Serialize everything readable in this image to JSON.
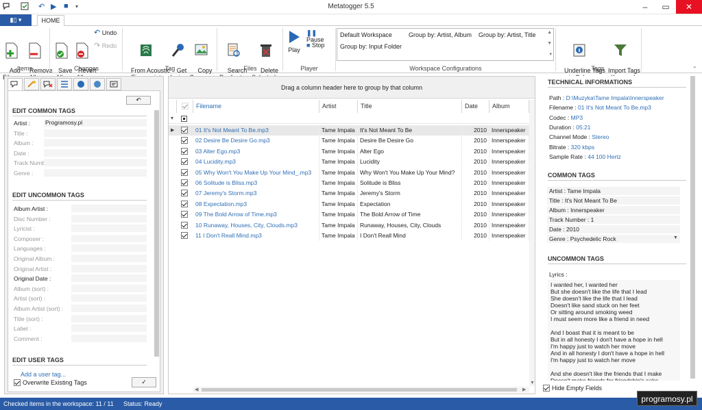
{
  "app": {
    "title": "Metatogger 5.5"
  },
  "ribbon": {
    "file_tab": "▮▯ ▾",
    "home_tab": "HOME",
    "items": {
      "add": "Add\nFiles ▾",
      "remove": "Remove\nAll ▾",
      "save": "Save\nAll ▾",
      "revert": "Revert\nAll ▾",
      "undo": "Undo",
      "redo": "Redo",
      "acoustic": "From Acoustic\nFingerprint",
      "lyrics": "Get\nLyrics",
      "covers": "Copy\nCovers ▾",
      "search": "Search\nDuplicates",
      "delete": "Delete\nSelected ▾",
      "play": "Play",
      "pause": "Pause",
      "stop": "Stop",
      "underline": "Underline Tags\nin Color",
      "import": "Import Tags\nas Keywords"
    },
    "groups": {
      "items": "Items",
      "changes": "Changes",
      "tag": "Tag",
      "files": "Files",
      "player": "Player",
      "workspace": "Workspace Configurations",
      "tags": "Tags"
    },
    "workspace": [
      "Default Workspace",
      "Group by: Artist, Album",
      "Group by: Artist, Title",
      "Group by: Input Folder"
    ]
  },
  "left": {
    "common_title": "EDIT COMMON TAGS",
    "common": [
      {
        "label": "Artist :",
        "value": "Programosy.pl",
        "bold": true
      },
      {
        "label": "Title :",
        "value": ""
      },
      {
        "label": "Album :",
        "value": ""
      },
      {
        "label": "Date :",
        "value": ""
      },
      {
        "label": "Track Number :",
        "value": ""
      },
      {
        "label": "Genre :",
        "value": ""
      }
    ],
    "uncommon_title": "EDIT UNCOMMON TAGS",
    "uncommon": [
      {
        "label": "Album Artist :",
        "bold": true
      },
      {
        "label": "Disc Number :"
      },
      {
        "label": "Lyricist :"
      },
      {
        "label": "Composer :"
      },
      {
        "label": "Languages :"
      },
      {
        "label": "Original Album :"
      },
      {
        "label": "Original Artist :"
      },
      {
        "label": "Original Date :",
        "bold": true
      },
      {
        "label": "Album (sort) :"
      },
      {
        "label": "Artist (sort) :"
      },
      {
        "label": "Album Artist (sort) :"
      },
      {
        "label": "Title (sort) :"
      },
      {
        "label": "Label :"
      },
      {
        "label": "Comment :"
      }
    ],
    "user_title": "EDIT USER TAGS",
    "add_user_tag": "Add a user tag...",
    "overwrite": "Overwrite Existing Tags"
  },
  "grid": {
    "group_hint": "Drag a column header here to group by that column",
    "headers": [
      "Filename",
      "Artist",
      "Title",
      "Date",
      "Album"
    ],
    "rows": [
      [
        "01 It's Not Meant To Be.mp3",
        "Tame Impala",
        "It's Not Meant To Be",
        "2010",
        "Innerspeaker"
      ],
      [
        "02 Desire Be Desire Go.mp3",
        "Tame Impala",
        "Desire Be Desire Go",
        "2010",
        "Innerspeaker"
      ],
      [
        "03 Alter Ego.mp3",
        "Tame Impala",
        "Alter Ego",
        "2010",
        "Innerspeaker"
      ],
      [
        "04 Lucidity.mp3",
        "Tame Impala",
        "Lucidity",
        "2010",
        "Innerspeaker"
      ],
      [
        "05 Why Won't You Make Up Your Mind_.mp3",
        "Tame Impala",
        "Why Won't You Make Up Your Mind?",
        "2010",
        "Innerspeaker"
      ],
      [
        "06 Solitude is Bliss.mp3",
        "Tame Impala",
        "Solitude is Bliss",
        "2010",
        "Innerspeaker"
      ],
      [
        "07 Jeremy's Storm.mp3",
        "Tame Impala",
        "Jeremy's Storm",
        "2010",
        "Innerspeaker"
      ],
      [
        "08 Expectation.mp3",
        "Tame Impala",
        "Expectation",
        "2010",
        "Innerspeaker"
      ],
      [
        "09 The Bold Arrow of Time.mp3",
        "Tame Impala",
        "The Bold Arrow of Time",
        "2010",
        "Innerspeaker"
      ],
      [
        "10 Runaway, Houses, City, Clouds.mp3",
        "Tame Impala",
        "Runaway, Houses, City, Clouds",
        "2010",
        "Innerspeaker"
      ],
      [
        "11 I Don't Reall Mind.mp3",
        "Tame Impala",
        "I Don't Reall Mind",
        "2010",
        "Innerspeaker"
      ]
    ]
  },
  "right": {
    "tech_title": "TECHNICAL INFORMATIONS",
    "tech": [
      {
        "label": "Path : ",
        "value": "D:\\Muzyka\\Tame Impala\\Innerspeaker"
      },
      {
        "label": "Filename : ",
        "value": "01 It's Not Meant To Be.mp3"
      },
      {
        "label": "Codec : ",
        "value": "MP3"
      },
      {
        "label": "Duration : ",
        "value": "05:21"
      },
      {
        "label": "Channel Mode : ",
        "value": "Stereo"
      },
      {
        "label": "Bitrate : ",
        "value": "320 kbps"
      },
      {
        "label": "Sample Rate : ",
        "value": "44 100 Hertz"
      }
    ],
    "common_title": "COMMON TAGS",
    "common": [
      "Artist :  Tame Impala",
      "Title :  It's Not Meant To Be",
      "Album :  Innerspeaker",
      "Track Number :  1",
      "Date :  2010",
      "Genre :  Psychedelic Rock"
    ],
    "uncommon_title": "UNCOMMON TAGS",
    "lyrics_label": "Lyrics :",
    "lyrics": "I wanted her, I wanted her\nBut she doesn't like the life that I lead\nShe doesn't like the life that I lead\nDoesn't like sand stuck on her feet\nOr sitting around smoking weed\nI must seem more like a friend in need\n\nAnd I boast that it is meant to be\nBut in all honesty I don't have a hope in hell\nI'm happy just to watch her move\nAnd in all honesty I don't have a hope in hell\nI'm happy just to watch her move\n\nAnd she doesn't like the friends that I make\nDoesn't make friends for friendship's sake",
    "hide_empty": "Hide Empty Fields"
  },
  "status": {
    "checked": "Checked items in the workspace:  11  /  11",
    "state": "Status:  Ready"
  },
  "watermark": "programosy.pl"
}
